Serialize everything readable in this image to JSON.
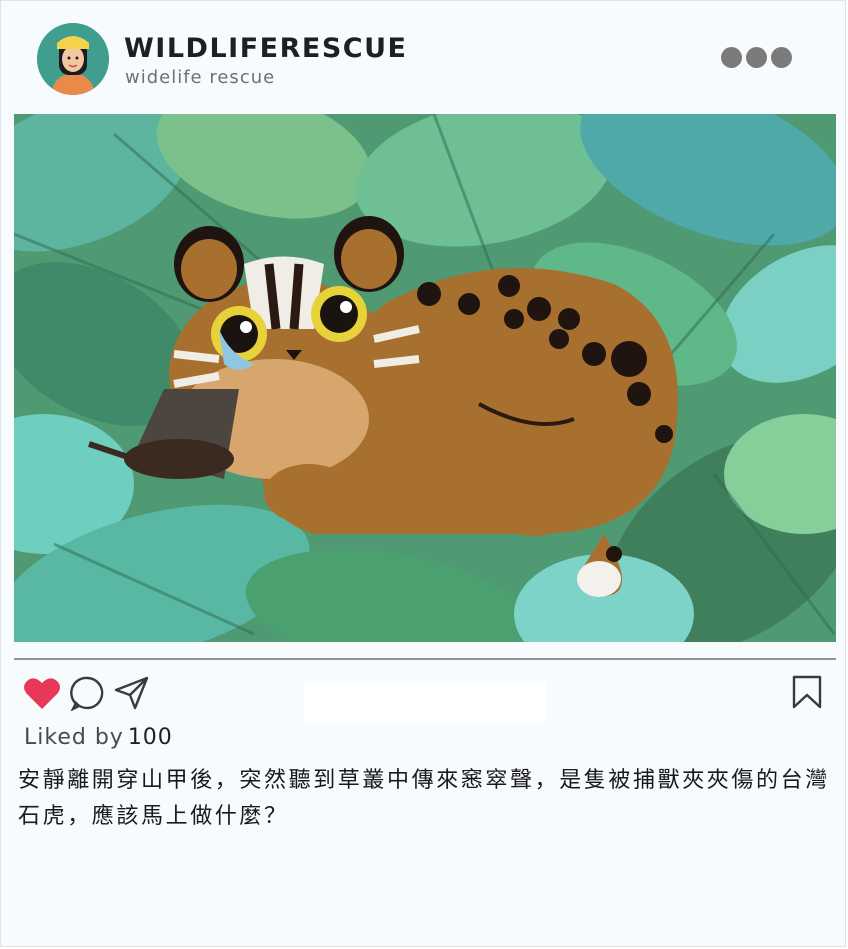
{
  "header": {
    "account_name": "WILDLIFERESCUE",
    "account_handle": "widelife rescue",
    "avatar_icon": "user-avatar",
    "more_icon": "more-dots-icon"
  },
  "post": {
    "image_subject": "leopard-cat-illustration",
    "likes_prefix": "Liked by",
    "likes_count": "100",
    "caption": "安靜離開穿山甲後，突然聽到草叢中傳來窸窣聲，是隻被捕獸夾夾傷的台灣石虎，應該馬上做什麼？"
  },
  "actions": {
    "like_icon": "heart-icon",
    "comment_icon": "comment-icon",
    "share_icon": "share-icon",
    "save_icon": "bookmark-icon",
    "like_color": "#e8385a"
  },
  "colors": {
    "card_bg": "#f7fbfe",
    "text": "#1a1a1a",
    "muted": "#707070"
  }
}
